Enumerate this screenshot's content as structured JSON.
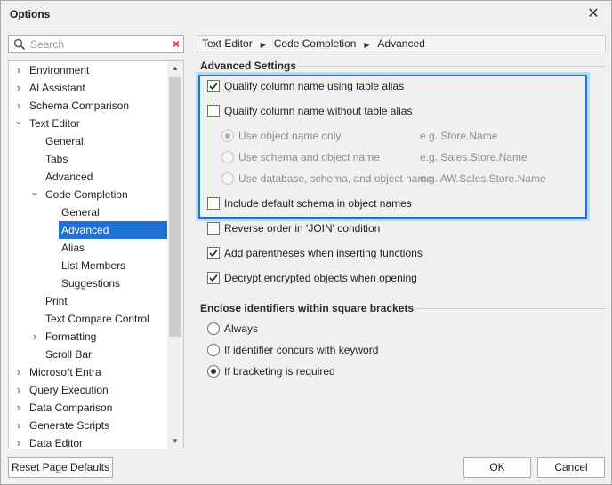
{
  "window": {
    "title": "Options",
    "close_icon": "close-icon"
  },
  "search": {
    "placeholder": "Search"
  },
  "tree": [
    {
      "label": "Environment",
      "level": 0,
      "expander": "collapsed"
    },
    {
      "label": "AI Assistant",
      "level": 0,
      "expander": "collapsed"
    },
    {
      "label": "Schema Comparison",
      "level": 0,
      "expander": "collapsed"
    },
    {
      "label": "Text Editor",
      "level": 0,
      "expander": "expanded"
    },
    {
      "label": "General",
      "level": 1,
      "expander": "none"
    },
    {
      "label": "Tabs",
      "level": 1,
      "expander": "none"
    },
    {
      "label": "Advanced",
      "level": 1,
      "expander": "none"
    },
    {
      "label": "Code Completion",
      "level": 1,
      "expander": "expanded"
    },
    {
      "label": "General",
      "level": 2,
      "expander": "none"
    },
    {
      "label": "Advanced",
      "level": 2,
      "expander": "none",
      "selected": true
    },
    {
      "label": "Alias",
      "level": 2,
      "expander": "none"
    },
    {
      "label": "List Members",
      "level": 2,
      "expander": "none"
    },
    {
      "label": "Suggestions",
      "level": 2,
      "expander": "none"
    },
    {
      "label": "Print",
      "level": 1,
      "expander": "none"
    },
    {
      "label": "Text Compare Control",
      "level": 1,
      "expander": "none"
    },
    {
      "label": "Formatting",
      "level": 1,
      "expander": "collapsed"
    },
    {
      "label": "Scroll Bar",
      "level": 1,
      "expander": "none"
    },
    {
      "label": "Microsoft Entra",
      "level": 0,
      "expander": "collapsed"
    },
    {
      "label": "Query Execution",
      "level": 0,
      "expander": "collapsed"
    },
    {
      "label": "Data Comparison",
      "level": 0,
      "expander": "collapsed"
    },
    {
      "label": "Generate Scripts",
      "level": 0,
      "expander": "collapsed"
    },
    {
      "label": "Data Editor",
      "level": 0,
      "expander": "collapsed"
    }
  ],
  "breadcrumb": [
    "Text Editor",
    "Code Completion",
    "Advanced"
  ],
  "advanced_settings": {
    "title": "Advanced Settings",
    "qualify_with_alias": {
      "label": "Qualify column name using table alias",
      "checked": true
    },
    "qualify_without_alias": {
      "label": "Qualify column name without table alias",
      "checked": false
    },
    "name_options": [
      {
        "label": "Use object name only",
        "example": "e.g. Store.Name",
        "selected": true
      },
      {
        "label": "Use schema and object name",
        "example": "e.g. Sales.Store.Name",
        "selected": false
      },
      {
        "label": "Use database, schema, and object name",
        "example": "e.g. AW.Sales.Store.Name",
        "selected": false
      }
    ],
    "include_default_schema": {
      "label": "Include default schema in object names",
      "checked": false
    },
    "reverse_join": {
      "label": "Reverse order in 'JOIN' condition",
      "checked": false
    },
    "add_parentheses": {
      "label": "Add parentheses when inserting functions",
      "checked": true
    },
    "decrypt_objects": {
      "label": "Decrypt encrypted objects when opening",
      "checked": true
    }
  },
  "brackets": {
    "title": "Enclose identifiers within square brackets",
    "options": [
      {
        "label": "Always",
        "selected": false
      },
      {
        "label": "If identifier concurs with keyword",
        "selected": false
      },
      {
        "label": "If bracketing is required",
        "selected": true
      }
    ]
  },
  "buttons": {
    "reset": "Reset Page Defaults",
    "ok": "OK",
    "cancel": "Cancel"
  },
  "colors": {
    "accent": "#1e73d2",
    "focus_glow": "#b9d8f6",
    "clear": "#d9262c"
  }
}
